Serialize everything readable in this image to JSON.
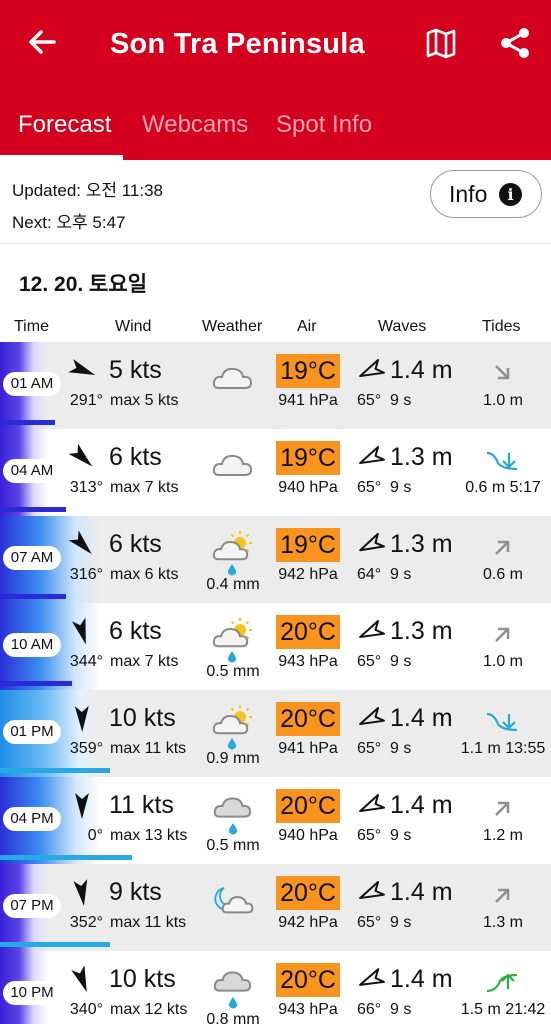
{
  "header": {
    "title": "Son Tra Peninsula",
    "tabs": [
      {
        "label": "Forecast",
        "active": true
      },
      {
        "label": "Webcams",
        "active": false
      },
      {
        "label": "Spot Info",
        "active": false
      }
    ]
  },
  "update": {
    "updated": "Updated: 오전 11:38",
    "next": "Next: 오후 5:47",
    "info_label": "Info"
  },
  "date": "12. 20. 토요일",
  "columns": [
    "Time",
    "Wind",
    "Weather",
    "Air",
    "Waves",
    "Tides"
  ],
  "colors": {
    "brand": "#d4001e",
    "temp_bg": "#f8941d",
    "tide_falling": "#29a8d6",
    "tide_rising": "#28b43c"
  },
  "rows": [
    {
      "time": "01 AM",
      "speed": "5 kts",
      "dir": "291°",
      "max": "max 5 kts",
      "weather": "cloudy",
      "precip": "",
      "air": "19°C",
      "pressure": "941 hPa",
      "wave": "1.4 m",
      "wave_dir": "65°",
      "wave_period": "9 s",
      "tide_icon": "tide-down-arrow",
      "tide": "1.0 m",
      "night_fraction": 1.0,
      "wind_fraction": 0.1
    },
    {
      "time": "04 AM",
      "speed": "6 kts",
      "dir": "313°",
      "max": "max 7 kts",
      "weather": "cloudy",
      "precip": "",
      "air": "19°C",
      "pressure": "940 hPa",
      "wave": "1.3 m",
      "wave_dir": "65°",
      "wave_period": "9 s",
      "tide_icon": "tide-low",
      "tide": "0.6 m 5:17",
      "night_fraction": 1.0,
      "wind_fraction": 0.12
    },
    {
      "time": "07 AM",
      "speed": "6 kts",
      "dir": "316°",
      "max": "max 6 kts",
      "weather": "partly-sunny-rain",
      "precip": "0.4 mm",
      "air": "19°C",
      "pressure": "942 hPa",
      "wave": "1.3 m",
      "wave_dir": "64°",
      "wave_period": "9 s",
      "tide_icon": "tide-up-arrow",
      "tide": "0.6 m",
      "night_fraction": 0.6,
      "wind_fraction": 0.12
    },
    {
      "time": "10 AM",
      "speed": "6 kts",
      "dir": "344°",
      "max": "max 7 kts",
      "weather": "partly-sunny-rain",
      "precip": "0.5 mm",
      "air": "20°C",
      "pressure": "943 hPa",
      "wave": "1.3 m",
      "wave_dir": "65°",
      "wave_period": "9 s",
      "tide_icon": "tide-up-arrow",
      "tide": "1.0 m",
      "night_fraction": 0.2,
      "wind_fraction": 0.13
    },
    {
      "time": "01 PM",
      "speed": "10 kts",
      "dir": "359°",
      "max": "max 11 kts",
      "weather": "partly-sunny-rain",
      "precip": "0.9 mm",
      "air": "20°C",
      "pressure": "941 hPa",
      "wave": "1.4 m",
      "wave_dir": "65°",
      "wave_period": "9 s",
      "tide_icon": "tide-high",
      "tide": "1.1 m 13:55",
      "night_fraction": 0.0,
      "wind_fraction": 0.2
    },
    {
      "time": "04 PM",
      "speed": "11 kts",
      "dir": "0°",
      "max": "max 13 kts",
      "weather": "cloud-rain",
      "precip": "0.5 mm",
      "air": "20°C",
      "pressure": "940 hPa",
      "wave": "1.4 m",
      "wave_dir": "65°",
      "wave_period": "9 s",
      "tide_icon": "tide-up-arrow",
      "tide": "1.2 m",
      "night_fraction": 0.3,
      "wind_fraction": 0.24
    },
    {
      "time": "07 PM",
      "speed": "9 kts",
      "dir": "352°",
      "max": "max 11 kts",
      "weather": "moon-cloudy",
      "precip": "",
      "air": "20°C",
      "pressure": "942 hPa",
      "wave": "1.4 m",
      "wave_dir": "65°",
      "wave_period": "9 s",
      "tide_icon": "tide-up-arrow",
      "tide": "1.3 m",
      "night_fraction": 1.0,
      "wind_fraction": 0.2
    },
    {
      "time": "10 PM",
      "speed": "10 kts",
      "dir": "340°",
      "max": "max 12 kts",
      "weather": "cloud-rain",
      "precip": "0.8 mm",
      "air": "20°C",
      "pressure": "943 hPa",
      "wave": "1.4 m",
      "wave_dir": "66°",
      "wave_period": "9 s",
      "tide_icon": "tide-rising-high",
      "tide": "1.5 m 21:42",
      "night_fraction": 1.0,
      "wind_fraction": 0.21
    }
  ]
}
